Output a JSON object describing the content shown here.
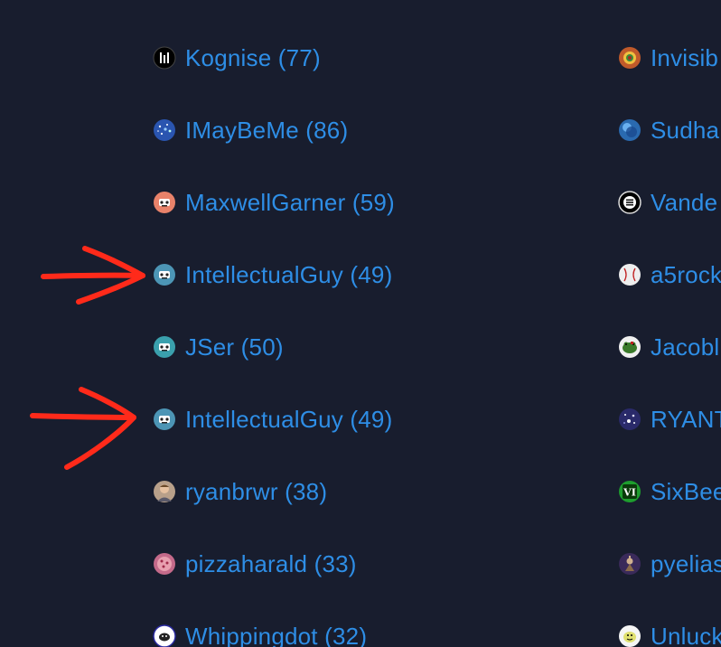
{
  "left_users": [
    {
      "name": "Kognise (77)",
      "avatar": "kognise-avatar-icon",
      "color": "#000000"
    },
    {
      "name": "IMayBeMe (86)",
      "avatar": "galaxy-avatar-icon",
      "color": "#2a55b0"
    },
    {
      "name": "MaxwellGarner (59)",
      "avatar": "robot-face-avatar-icon",
      "color": "#e8826a"
    },
    {
      "name": "IntellectualGuy (49)",
      "avatar": "robot-face-avatar-icon",
      "color": "#4c95b5"
    },
    {
      "name": "JSer (50)",
      "avatar": "robot-face-avatar-icon",
      "color": "#3aa0ad"
    },
    {
      "name": "IntellectualGuy (49)",
      "avatar": "robot-face-avatar-icon",
      "color": "#4c95b5"
    },
    {
      "name": "ryanbrwr (38)",
      "avatar": "person-photo-avatar-icon",
      "color": "#b8a08a"
    },
    {
      "name": "pizzaharald (33)",
      "avatar": "pizza-avatar-icon",
      "color": "#c46a8a"
    },
    {
      "name": "Whippingdot (32)",
      "avatar": "sheep-avatar-icon",
      "color": "#ffffff"
    }
  ],
  "right_users": [
    {
      "name": "Invisib",
      "avatar": "colorful-avatar-icon",
      "color": "#c05a2a"
    },
    {
      "name": "Sudha",
      "avatar": "blue-orb-avatar-icon",
      "color": "#2a6ab0"
    },
    {
      "name": "Vande",
      "avatar": "menu-lines-avatar-icon",
      "color": "#000000"
    },
    {
      "name": "a5rock",
      "avatar": "baseball-avatar-icon",
      "color": "#eeeeee"
    },
    {
      "name": "Jacobl",
      "avatar": "frog-avatar-icon",
      "color": "#3a7a2a"
    },
    {
      "name": "RYANT",
      "avatar": "starfield-avatar-icon",
      "color": "#2a2a6a"
    },
    {
      "name": "SixBee",
      "avatar": "roman-six-avatar-icon",
      "color": "#1e9e2e"
    },
    {
      "name": "pyelias",
      "avatar": "character-avatar-icon",
      "color": "#3a2a5a"
    },
    {
      "name": "Unluck",
      "avatar": "cartoon-avatar-icon",
      "color": "#e0e070"
    }
  ],
  "annotation_color": "#ff2a1a"
}
